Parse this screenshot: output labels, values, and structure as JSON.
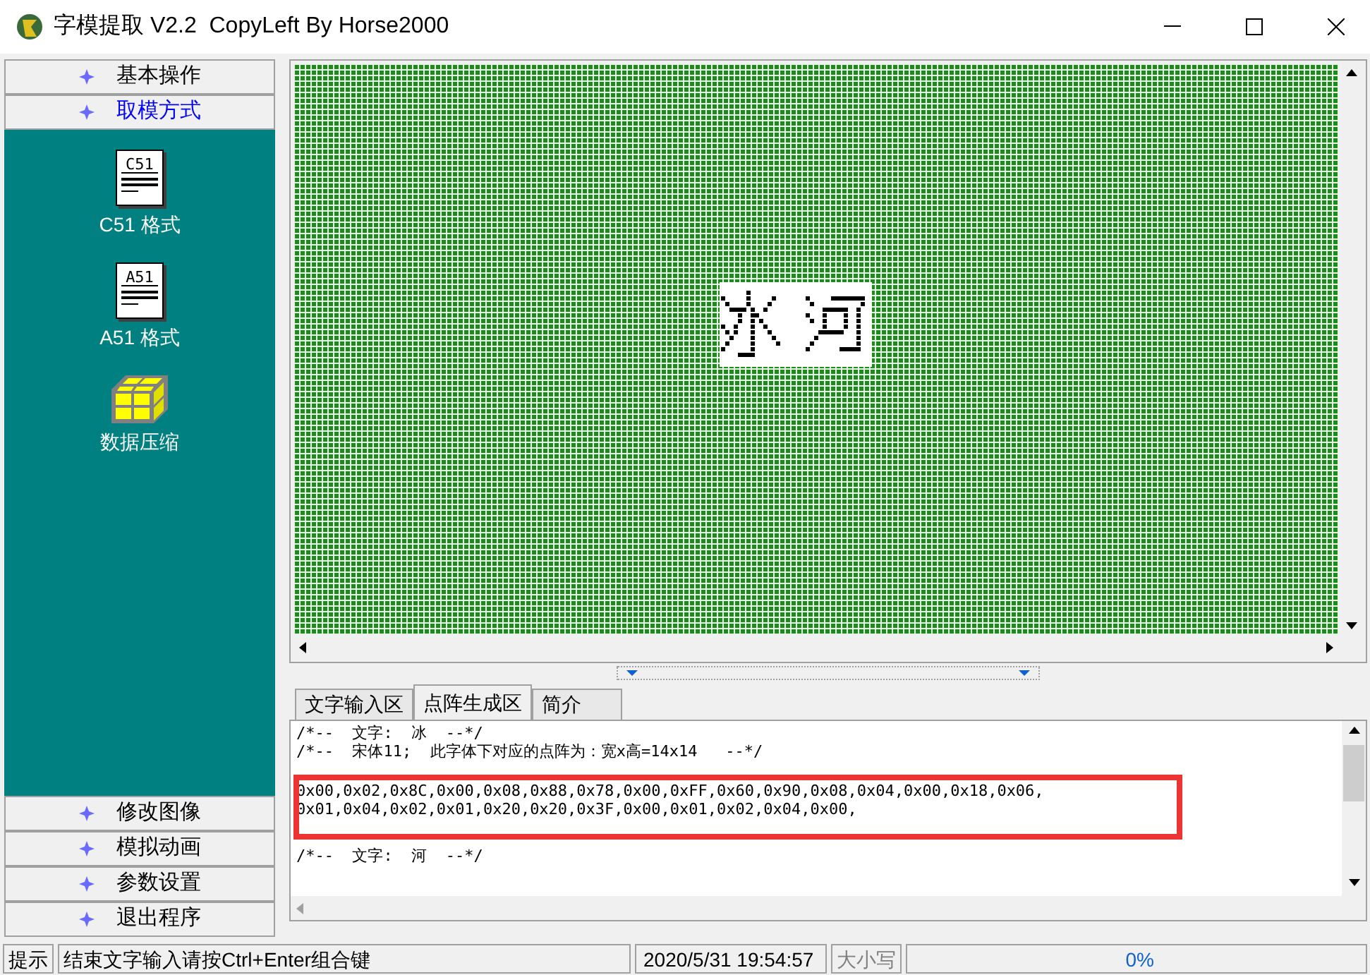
{
  "window": {
    "title": "字模提取 V2.2  CopyLeft By Horse2000"
  },
  "sidebar": {
    "top_sections": [
      {
        "label": "基本操作",
        "selected": false
      },
      {
        "label": "取模方式",
        "selected": true
      }
    ],
    "panel_items": [
      {
        "kind": "notepad",
        "icon_text": "C51",
        "label": "C51 格式"
      },
      {
        "kind": "notepad",
        "icon_text": "A51",
        "label": "A51 格式"
      },
      {
        "kind": "cube",
        "label": "数据压缩"
      }
    ],
    "bottom_sections": [
      {
        "label": "修改图像",
        "selected": false
      },
      {
        "label": "模拟动画",
        "selected": false
      },
      {
        "label": "参数设置",
        "selected": false
      },
      {
        "label": "退出程序",
        "selected": false
      }
    ]
  },
  "tabs": [
    {
      "label": "文字输入区",
      "selected": false
    },
    {
      "label": "点阵生成区",
      "selected": true
    },
    {
      "label": "简介",
      "selected": false
    }
  ],
  "output": {
    "lines": [
      "/*--  文字:  冰  --*/",
      "/*--  宋体11;  此字体下对应的点阵为：宽x高=14x14   --*/",
      "0x00,0x02,0x8C,0x00,0x08,0x88,0x78,0x00,0xFF,0x60,0x90,0x08,0x04,0x00,0x18,0x06,",
      "0x01,0x04,0x02,0x01,0x20,0x20,0x3F,0x00,0x01,0x02,0x04,0x00,",
      "/*--  文字:  河  --*/"
    ]
  },
  "status_bar": {
    "label": "提示",
    "message": "结束文字输入请按Ctrl+Enter组合键",
    "datetime": "2020/5/31 19:54:57",
    "caps": "大小写",
    "progress": "0%"
  }
}
